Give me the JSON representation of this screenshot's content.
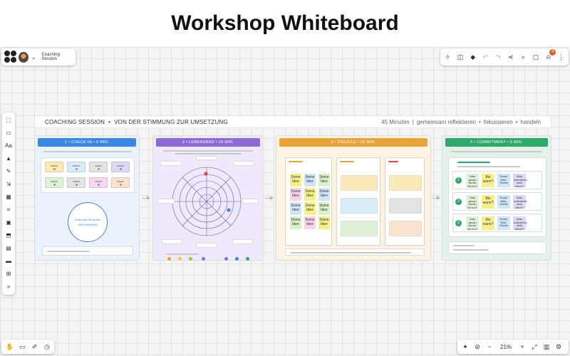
{
  "page_heading": "Workshop Whiteboard",
  "toolbar": {
    "board_name": "Coaching Session",
    "notification_count": "4",
    "zoom_level": "21%"
  },
  "board": {
    "title": "COACHING SESSION",
    "subtitle": "VON DER STIMMUNG ZUR UMSETZUNG",
    "meta": [
      "45 Minuten",
      "gemeinsam reflektieren",
      "fokussieren",
      "handeln"
    ]
  },
  "frames": [
    {
      "title": "1 • CHECK-IN • 5 MIN.",
      "circle_text": [
        "Schön dass Sie da sind",
        "HIER EINGEBEN"
      ]
    },
    {
      "title": "2 • LEBENSRAD • 15 MIN."
    },
    {
      "title": "3 • ZIELBILD • 20 MIN.",
      "sticky_text": [
        "Deine",
        "Idee"
      ]
    },
    {
      "title": "4 • COMMITMENT • 5 MIN.",
      "row_text": [
        "Was genau werde ich tun?",
        "Bis wann?",
        "Erster Mini-Schritt",
        "Was unterstützt mich dabei?"
      ]
    }
  ],
  "colors": {
    "frame1": "#3b86e0",
    "frame2": "#8c6ad8",
    "frame3": "#e8a33a",
    "frame4": "#2fa86c",
    "notification_badge": "#e85a2b"
  }
}
